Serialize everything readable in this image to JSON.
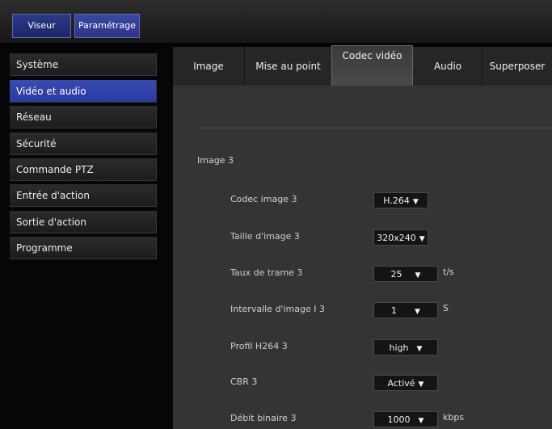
{
  "top_nav": {
    "viewer_label": "Viseur",
    "settings_label": "Paramétrage"
  },
  "sidebar": {
    "items": [
      {
        "label": "Système"
      },
      {
        "label": "Vidéo et audio"
      },
      {
        "label": "Réseau"
      },
      {
        "label": "Sécurité"
      },
      {
        "label": "Commande PTZ"
      },
      {
        "label": "Entrée d'action"
      },
      {
        "label": "Sortie d'action"
      },
      {
        "label": "Programme"
      }
    ],
    "active_index": 1
  },
  "tabs": [
    {
      "label": "Image"
    },
    {
      "label": "Mise au point"
    },
    {
      "label": "Codec vidéo"
    },
    {
      "label": "Audio"
    },
    {
      "label": "Superposer"
    }
  ],
  "section": {
    "title": "Image 3",
    "rows": [
      {
        "label": "Codec image 3",
        "value": "H.264",
        "unit": ""
      },
      {
        "label": "Taille d'image 3",
        "value": "320x240",
        "unit": ""
      },
      {
        "label": "Taux de trame 3",
        "value": "25",
        "unit": "t/s"
      },
      {
        "label": "Intervalle d'image I 3",
        "value": "1",
        "unit": "S"
      },
      {
        "label": "Profil H264 3",
        "value": "high",
        "unit": ""
      },
      {
        "label": "CBR 3",
        "value": "Activé",
        "unit": ""
      },
      {
        "label": "Débit binaire 3",
        "value": "1000",
        "unit": "kbps"
      }
    ]
  },
  "colors": {
    "accent": "#2a39a0",
    "background": "#050505",
    "panel": "#343434"
  },
  "icons": {
    "dropdown": "chevron-down-icon"
  }
}
